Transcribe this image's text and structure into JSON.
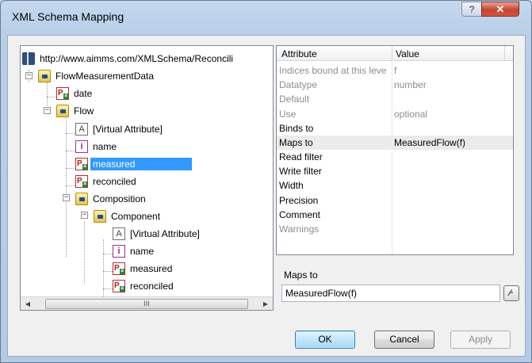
{
  "window": {
    "title": "XML Schema Mapping",
    "help_glyph": "?",
    "close_glyph": "✕"
  },
  "tree": {
    "root_label": "http://www.aimms.com/XMLSchema/Reconcili",
    "nodes": [
      {
        "label": "FlowMeasurementData",
        "icon": "folder-icon"
      },
      {
        "label": "date",
        "icon": "parameter-icon"
      },
      {
        "label": "Flow",
        "icon": "folder-icon"
      },
      {
        "label": "[Virtual Attribute]",
        "icon": "attribute-icon"
      },
      {
        "label": "name",
        "icon": "index-icon"
      },
      {
        "label": "measured",
        "icon": "parameter-icon",
        "selected": true
      },
      {
        "label": "reconciled",
        "icon": "parameter-icon"
      },
      {
        "label": "Composition",
        "icon": "folder-icon"
      },
      {
        "label": "Component",
        "icon": "folder-icon"
      },
      {
        "label": "[Virtual Attribute]",
        "icon": "attribute-icon"
      },
      {
        "label": "name",
        "icon": "index-icon"
      },
      {
        "label": "measured",
        "icon": "parameter-icon"
      },
      {
        "label": "reconciled",
        "icon": "parameter-icon"
      }
    ],
    "scroll_thumb_glyph": "III"
  },
  "grid": {
    "header": {
      "attribute": "Attribute",
      "value": "Value"
    },
    "rows": [
      {
        "attribute": "Indices bound at this leve",
        "value": "f",
        "disabled": true
      },
      {
        "attribute": "Datatype",
        "value": "number",
        "disabled": true
      },
      {
        "attribute": "Default",
        "value": "",
        "disabled": true
      },
      {
        "attribute": "Use",
        "value": "optional",
        "disabled": true
      },
      {
        "attribute": "Binds to",
        "value": ""
      },
      {
        "attribute": "Maps to",
        "value": "MeasuredFlow(f)",
        "highlighted": true
      },
      {
        "attribute": "Read filter",
        "value": ""
      },
      {
        "attribute": "Write filter",
        "value": ""
      },
      {
        "attribute": "Width",
        "value": ""
      },
      {
        "attribute": "Precision",
        "value": ""
      },
      {
        "attribute": "Comment",
        "value": ""
      },
      {
        "attribute": "Warnings",
        "value": "",
        "disabled": true
      }
    ]
  },
  "editor": {
    "label": "Maps to",
    "value": "MeasuredFlow(f)",
    "wizard_glyph": "⁄·"
  },
  "buttons": {
    "ok": "OK",
    "cancel": "Cancel",
    "apply": "Apply"
  }
}
